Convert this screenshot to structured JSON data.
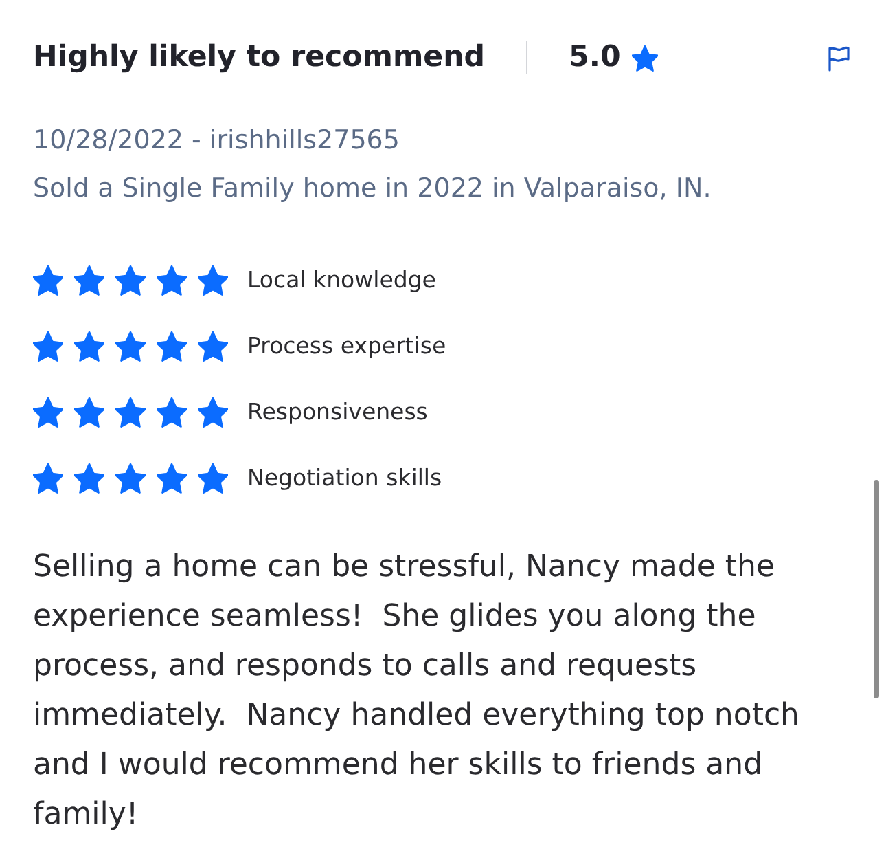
{
  "header": {
    "title": "Highly likely to recommend",
    "rating": "5.0"
  },
  "review": {
    "date_author": "10/28/2022 - irishhills27565",
    "transaction": "Sold a Single Family home in 2022 in Valparaiso, IN."
  },
  "ratings": [
    {
      "label": "Local knowledge",
      "stars": 5
    },
    {
      "label": "Process expertise",
      "stars": 5
    },
    {
      "label": "Responsiveness",
      "stars": 5
    },
    {
      "label": "Negotiation skills",
      "stars": 5
    }
  ],
  "body": "Selling a home can be stressful, Nancy made the experience seamless!  She glides you along the process, and responds to calls and requests immediately.  Nancy handled everything top notch and I would recommend her skills to friends and family!"
}
